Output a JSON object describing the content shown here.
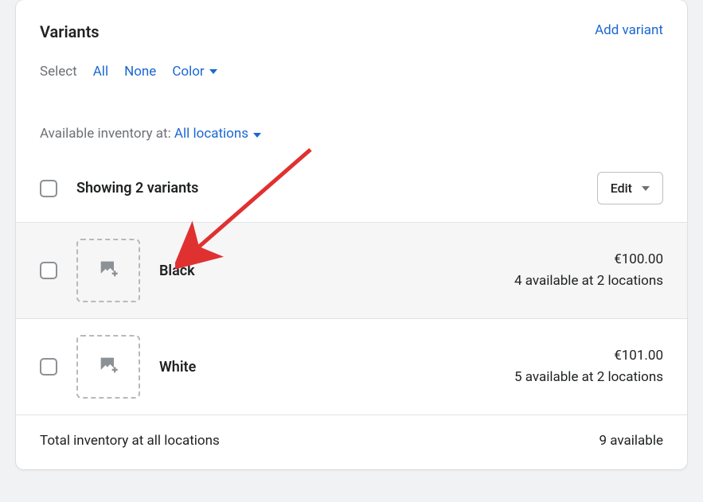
{
  "header": {
    "title": "Variants",
    "add_link": "Add variant"
  },
  "select": {
    "label": "Select",
    "all": "All",
    "none": "None",
    "color": "Color"
  },
  "inventory": {
    "label": "Available inventory at: ",
    "location": "All locations"
  },
  "list_header": {
    "showing": "Showing 2 variants",
    "edit": "Edit"
  },
  "variants": [
    {
      "name": "Black",
      "price": "€100.00",
      "stock": "4 available at 2 locations",
      "hovered": true
    },
    {
      "name": "White",
      "price": "€101.00",
      "stock": "5 available at 2 locations",
      "hovered": false
    }
  ],
  "footer": {
    "label": "Total inventory at all locations",
    "total": "9 available"
  }
}
